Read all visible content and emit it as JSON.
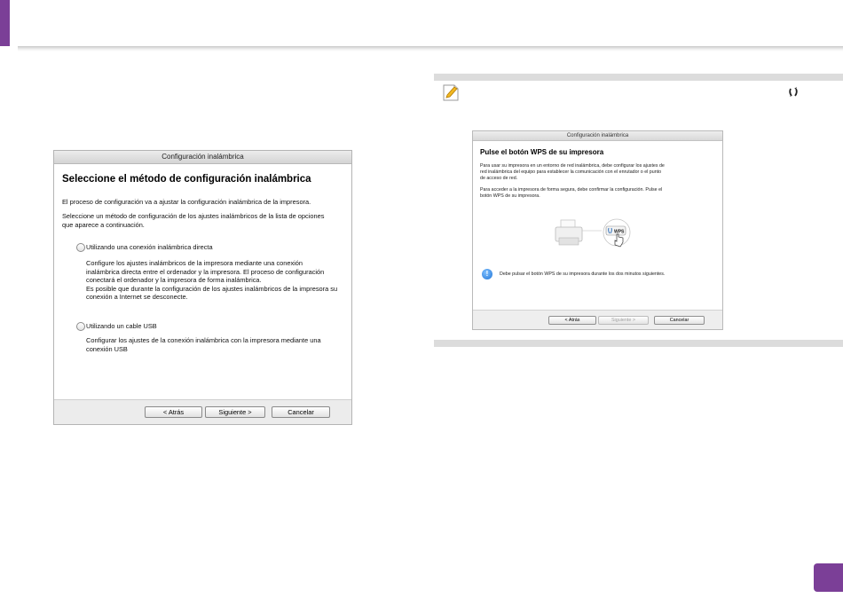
{
  "left_dialog": {
    "title": "Configuración inalámbrica",
    "heading": "Seleccione el método de configuración inalámbrica",
    "intro1": "El proceso de configuración va a ajustar la configuración inalámbrica de la impresora.",
    "intro2_line1": "Seleccione un método de configuración de los ajustes inalámbricos de la lista de opciones",
    "intro2_line2": "que aparece a continuación.",
    "option1": {
      "label": "Utilizando una conexión inalámbrica directa",
      "desc_lines": [
        "Configure los ajustes inalámbricos de la impresora mediante una conexión",
        "inalámbrica directa entre el ordenador y la impresora. El proceso de configuración",
        "conectará el ordenador y la impresora de forma inalámbrica.",
        "Es posible que durante la configuración de los ajustes inalámbricos de la impresora su",
        "conexión a Internet se desconecte."
      ]
    },
    "option2": {
      "label": "Utilizando un cable USB",
      "desc_lines": [
        "Configurar los ajustes de la conexión inalámbrica con la impresora mediante una",
        "conexión USB"
      ]
    },
    "buttons": {
      "back": "< Atrás",
      "next": "Siguiente >",
      "cancel": "Cancelar"
    }
  },
  "right_dialog": {
    "title": "Configuración inalámbrica",
    "heading": "Pulse el botón WPS de su impresora",
    "para1_lines": [
      "Para usar su impresora en un entorno de red inalámbrica, debe configurar los ajustes de",
      "red inalámbrica del equipo para establecer la comunicación con el enrutador o el punto",
      "de acceso de red."
    ],
    "para2_lines": [
      "Para acceder a la impresora de forma segura, debe confirmar la configuración. Pulse el",
      "botón WPS de su impresora."
    ],
    "wps_label": "WPS",
    "info_text": "Debe pulsar el botón WPS de su impresora durante los dos minutos siguientes.",
    "buttons": {
      "back": "< Atrás",
      "next": "Siguiente >",
      "cancel": "Cancelar"
    }
  },
  "colors": {
    "accent": "#7b3f97",
    "note_bar": "#dcdcdc"
  }
}
